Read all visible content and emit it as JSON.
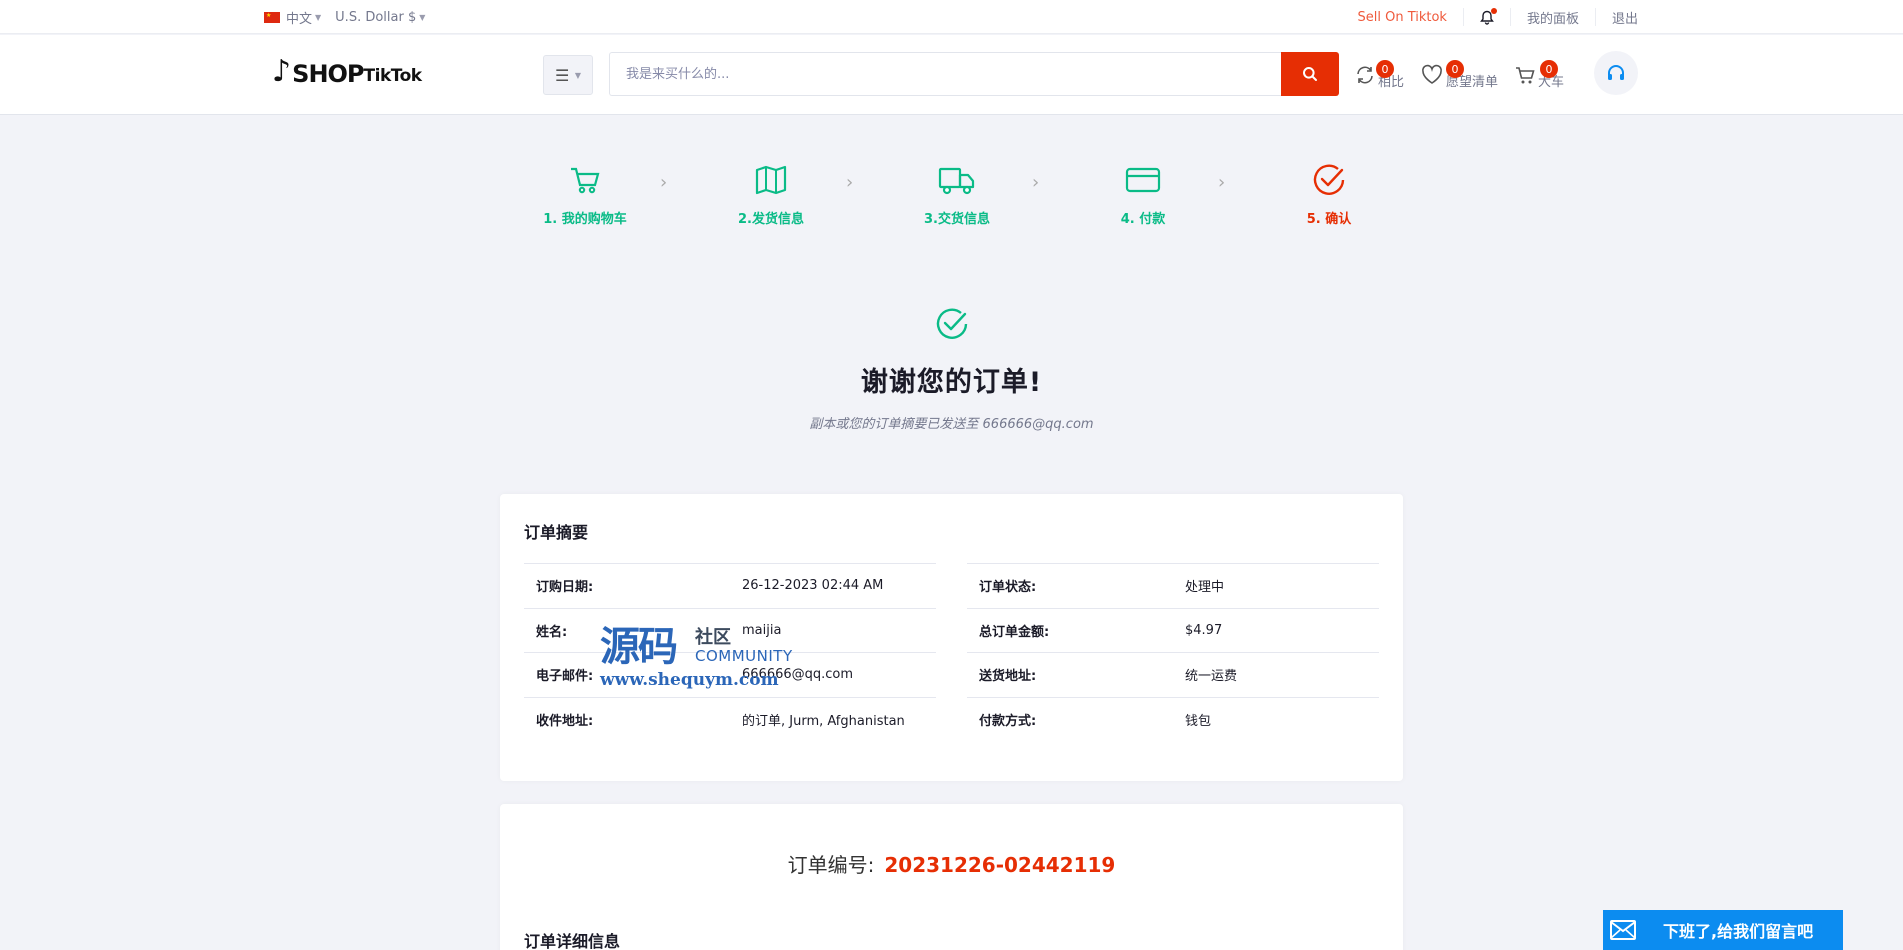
{
  "topbar": {
    "language": "中文",
    "currency": "U.S. Dollar $",
    "sell_link": "Sell On Tiktok",
    "dashboard_link": "我的面板",
    "logout_link": "退出"
  },
  "header": {
    "logo": {
      "shop": "SHOP",
      "tiktok": "TikTok"
    },
    "search_placeholder": "我是来买什么的...",
    "compare": {
      "label": "相比",
      "count": "0"
    },
    "wishlist": {
      "label": "愿望清单",
      "count": "0"
    },
    "cart": {
      "label": "大车",
      "count": "0"
    }
  },
  "steps": [
    {
      "label": "1. 我的购物车",
      "icon": "cart-icon"
    },
    {
      "label": "2.发货信息",
      "icon": "map-icon"
    },
    {
      "label": "3.交货信息",
      "icon": "truck-icon"
    },
    {
      "label": "4. 付款",
      "icon": "credit-card-icon"
    },
    {
      "label": "5. 确认",
      "icon": "check-circle-icon"
    }
  ],
  "confirmation": {
    "title": "谢谢您的订单!",
    "subtitle": "副本或您的订单摘要已发送至 666666@qq.com"
  },
  "summary": {
    "title": "订单摘要",
    "left": [
      {
        "key": "订购日期:",
        "value": "26-12-2023 02:44 AM"
      },
      {
        "key": "姓名:",
        "value": "maijia"
      },
      {
        "key": "电子邮件:",
        "value": "666666@qq.com"
      },
      {
        "key": "收件地址:",
        "value": "的订单, Jurm, Afghanistan"
      }
    ],
    "right": [
      {
        "key": "订单状态:",
        "value": "处理中"
      },
      {
        "key": "总订单金额:",
        "value": "$4.97"
      },
      {
        "key": "送货地址:",
        "value": "统一运费"
      },
      {
        "key": "付款方式:",
        "value": "钱包"
      }
    ]
  },
  "order": {
    "number_label": "订单编号:",
    "number": "20231226-02442119",
    "details_title": "订单详细信息"
  },
  "watermark": {
    "main": "源码",
    "sub": "社区",
    "community": "COMMUNITY",
    "url": "www.shequym.com"
  },
  "chat": {
    "label": "下班了,给我们留言吧"
  },
  "colors": {
    "accent": "#e62e04",
    "success": "#0abb87",
    "chat": "#0c8cf0"
  }
}
